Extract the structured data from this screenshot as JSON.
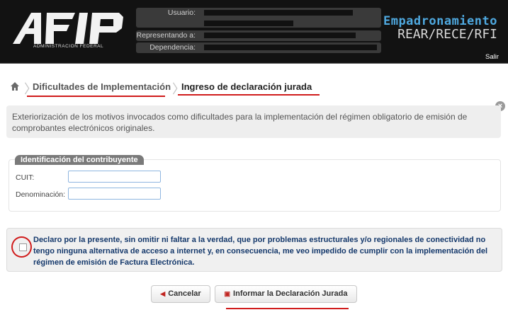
{
  "header": {
    "logo_alt": "AFIP",
    "logo_subtitle": "ADMINISTRACION FEDERAL",
    "user_fields": [
      {
        "label": "Usuario:"
      },
      {
        "label": "Representando a:"
      },
      {
        "label": "Dependencia:"
      }
    ],
    "app_title": "Empadronamiento",
    "app_subtitle": "REAR/RECE/RFI",
    "logout_label": "Salir"
  },
  "breadcrumb": {
    "items": [
      {
        "label": "Dificultades de Implementación"
      },
      {
        "label": "Ingreso de declaración jurada"
      }
    ]
  },
  "info": {
    "text": "Exteriorización de los motivos invocados como dificultades para la implementación del régimen obligatorio de emisión de comprobantes electrónicos originales."
  },
  "identification": {
    "title": "Identificación del contribuyente",
    "fields": [
      {
        "label": "CUIT:",
        "value": ""
      },
      {
        "label": "Denominación:",
        "value": ""
      }
    ]
  },
  "declaration": {
    "checked": false,
    "text": "Declaro por la presente, sin omitir ni faltar a la verdad, que por problemas estructurales y/o regionales de conectividad no tengo ninguna alternativa de acceso a internet y, en consecuencia, me veo impedido de cumplir con la implementación del régimen de emisión de Factura Electrónica."
  },
  "actions": {
    "cancel_label": "Cancelar",
    "submit_label": "Informar la Declaración Jurada"
  },
  "colors": {
    "accent_red": "#d01c1c",
    "brand_blue": "#4fa9e0",
    "declaration_text": "#14386b"
  }
}
